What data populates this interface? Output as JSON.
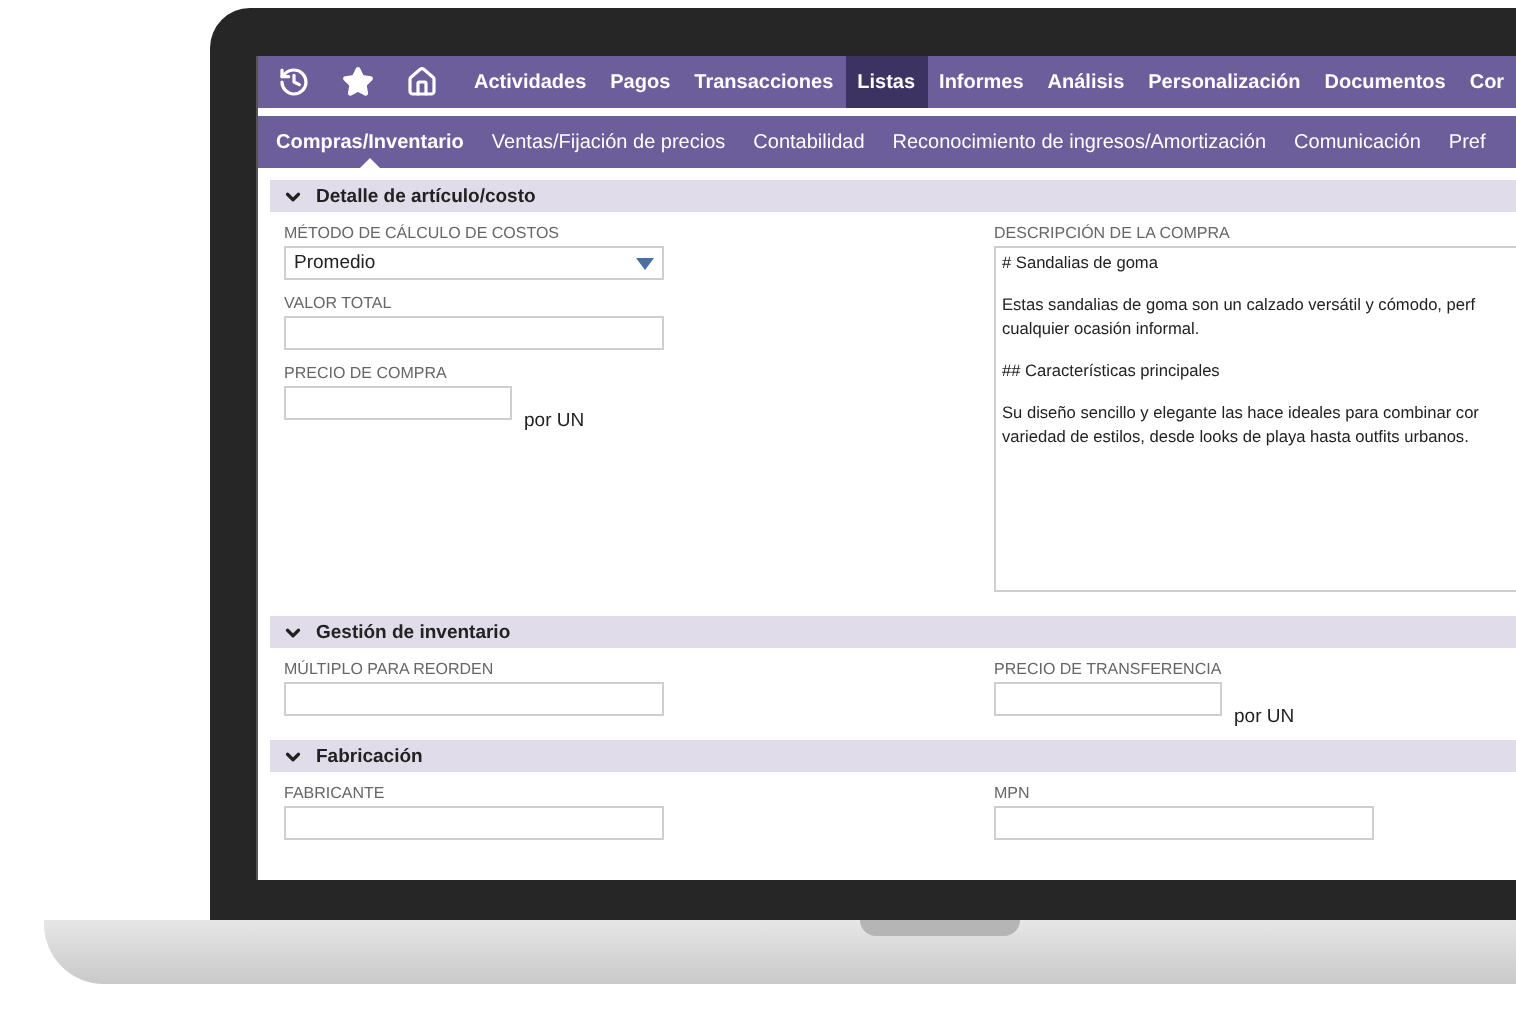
{
  "nav": {
    "items": [
      {
        "label": "Actividades",
        "selected": false
      },
      {
        "label": "Pagos",
        "selected": false
      },
      {
        "label": "Transacciones",
        "selected": false
      },
      {
        "label": "Listas",
        "selected": true
      },
      {
        "label": "Informes",
        "selected": false
      },
      {
        "label": "Análisis",
        "selected": false
      },
      {
        "label": "Personalización",
        "selected": false
      },
      {
        "label": "Documentos",
        "selected": false
      },
      {
        "label": "Cor",
        "selected": false
      }
    ]
  },
  "subtabs": [
    {
      "label": "Compras/Inventario",
      "selected": true
    },
    {
      "label": "Ventas/Fijación de precios",
      "selected": false
    },
    {
      "label": "Contabilidad",
      "selected": false
    },
    {
      "label": "Reconocimiento de ingresos/Amortización",
      "selected": false
    },
    {
      "label": "Comunicación",
      "selected": false
    },
    {
      "label": "Pref",
      "selected": false
    }
  ],
  "sections": [
    {
      "title": "Detalle de artículo/costo",
      "expanded": true,
      "left": [
        {
          "kind": "select",
          "label": "MÉTODO DE CÁLCULO DE COSTOS",
          "value": "Promedio"
        },
        {
          "kind": "text",
          "label": "VALOR TOTAL"
        },
        {
          "kind": "unit",
          "label": "PRECIO DE COMPRA",
          "suffix": "por UN"
        }
      ],
      "right": [
        {
          "kind": "textarea",
          "label": "DESCRIPCIÓN DE LA COMPRA",
          "paragraphs": [
            [
              "# Sandalias de goma"
            ],
            [
              "Estas sandalias de goma son un calzado versátil y cómodo, perf",
              "cualquier ocasión informal."
            ],
            [
              "## Características principales"
            ],
            [
              "Su diseño sencillo y elegante las hace ideales para combinar cor",
              "variedad de estilos, desde looks de playa hasta outfits urbanos."
            ]
          ]
        }
      ]
    },
    {
      "title": "Gestión de inventario",
      "expanded": true,
      "left": [
        {
          "kind": "text",
          "label": "MÚLTIPLO PARA REORDEN"
        }
      ],
      "right": [
        {
          "kind": "unit",
          "label": "PRECIO DE TRANSFERENCIA",
          "suffix": "por UN"
        }
      ]
    },
    {
      "title": "Fabricación",
      "expanded": true,
      "left": [
        {
          "kind": "text",
          "label": "FABRICANTE"
        }
      ],
      "right": [
        {
          "kind": "text",
          "label": "MPN"
        }
      ]
    }
  ]
}
